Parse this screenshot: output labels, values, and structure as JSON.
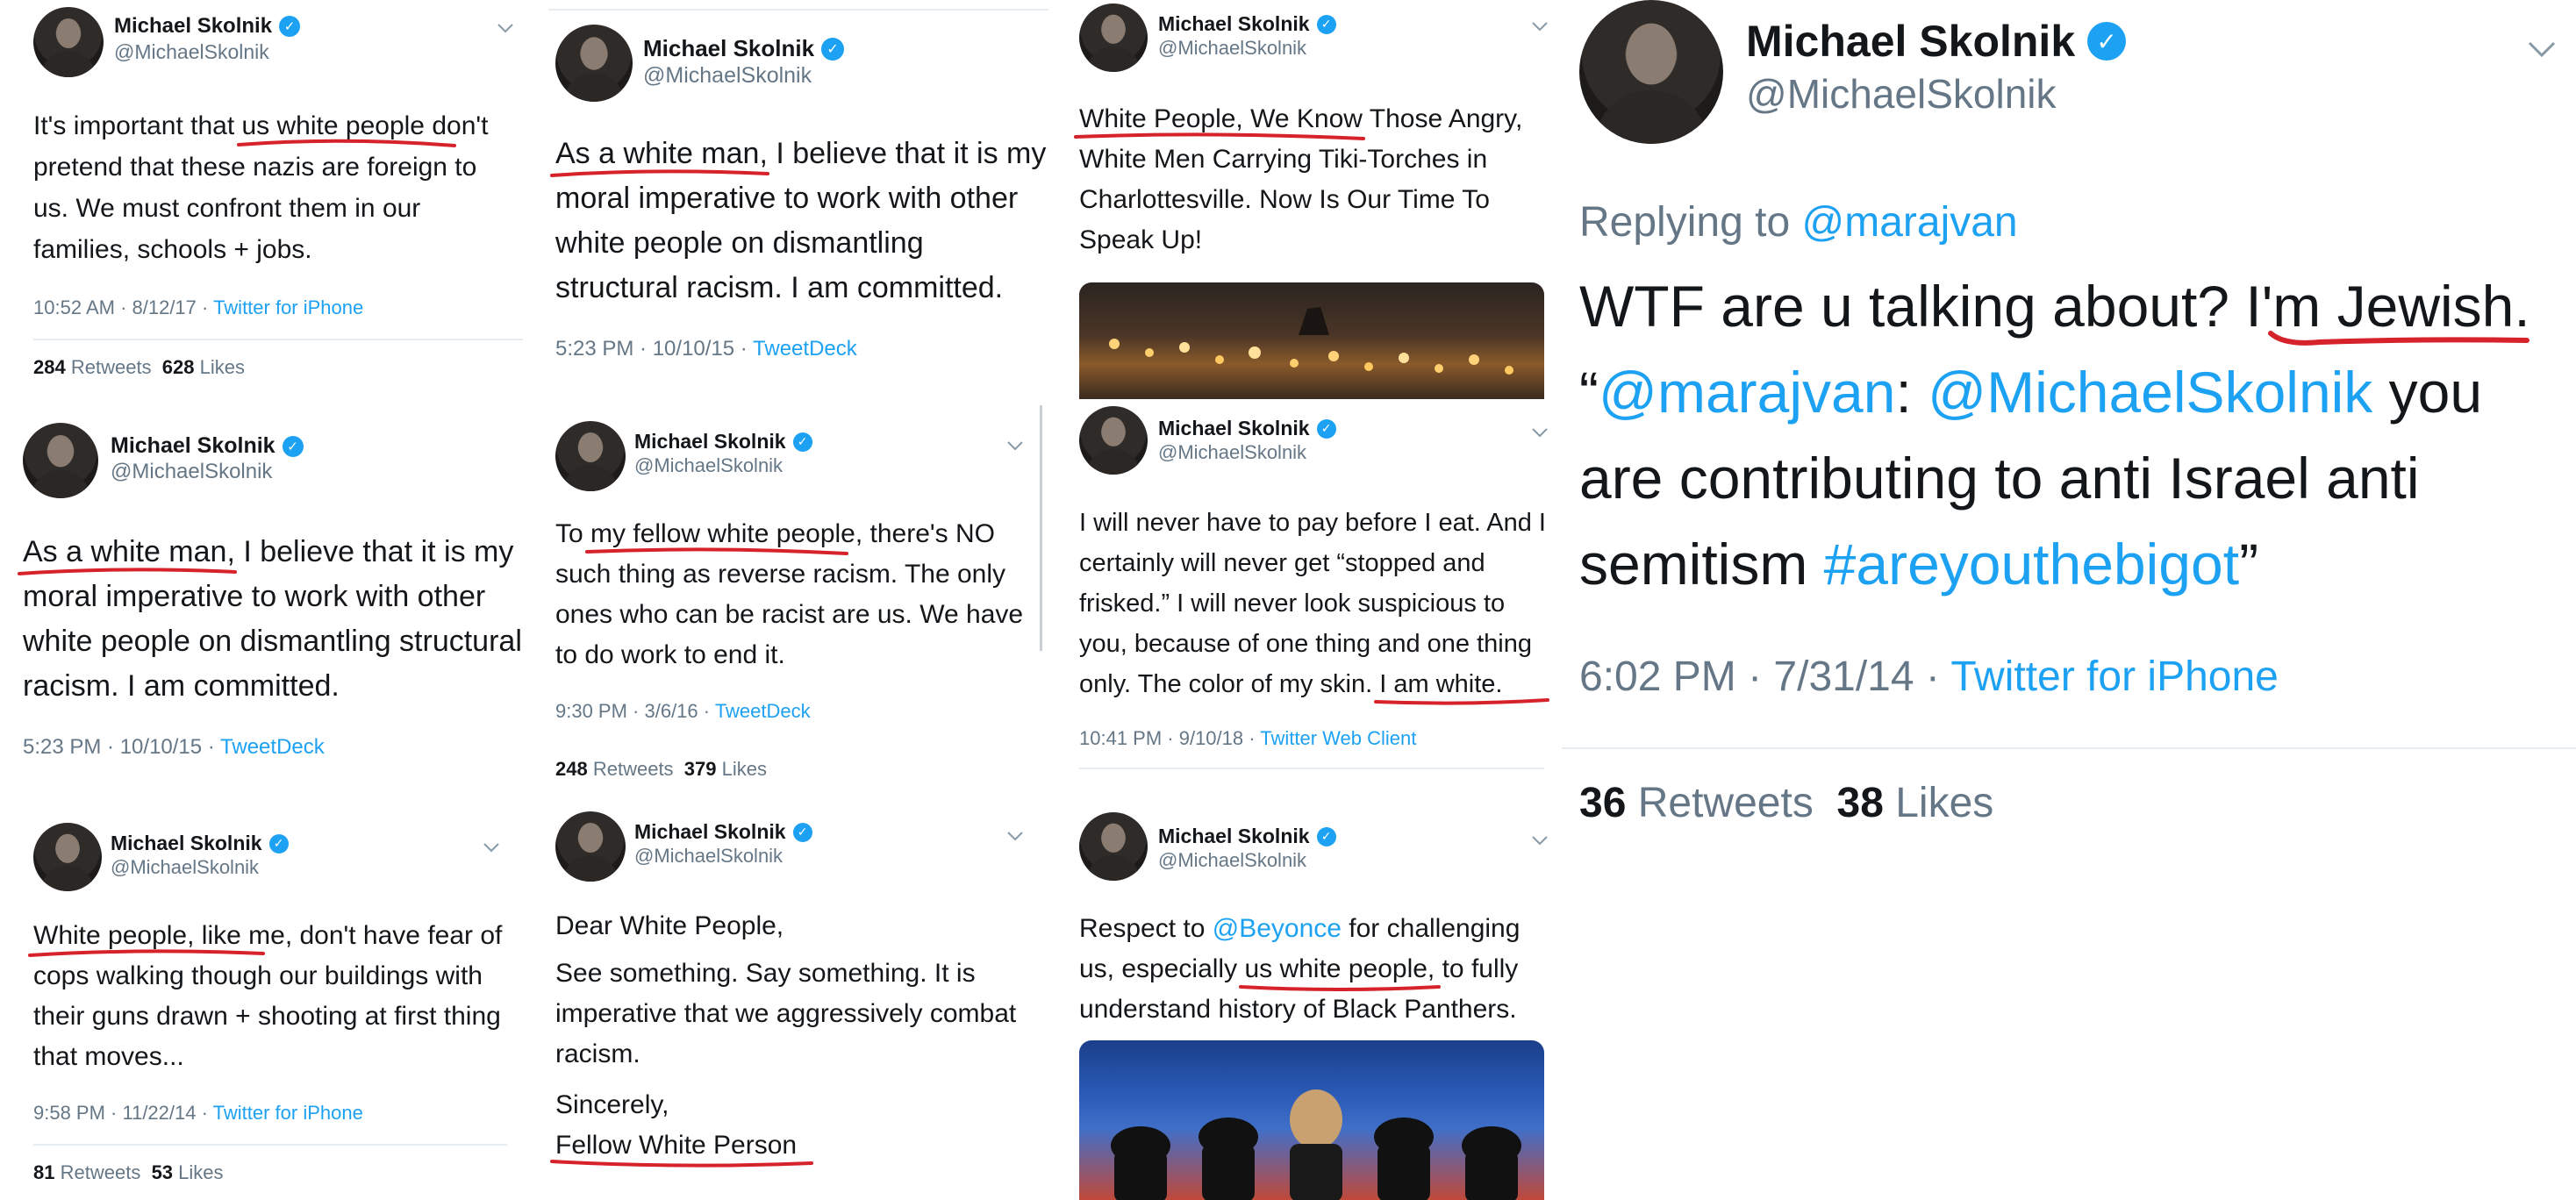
{
  "author": {
    "name": "Michael Skolnik",
    "handle": "@MichaelSkolnik"
  },
  "colors": {
    "accent": "#1da1f2",
    "underline": "#d6222a",
    "muted": "#657786",
    "text": "#14171a"
  },
  "icons": {
    "verified": "verified-badge-icon",
    "menu": "chevron-down-icon"
  },
  "t1": {
    "l1": "It's important that ",
    "u1": "us white people",
    "l2": " don't pretend that these nazis are foreign to us. We must confront them in our families, schools + jobs.",
    "time": "10:52 AM · 8/12/17 · ",
    "src": "Twitter for iPhone",
    "retweets": "284",
    "retweets_label": "Retweets",
    "likes": "628",
    "likes_label": "Likes"
  },
  "t2": {
    "u1": "As a white man, I",
    "l1": " believe that it is my moral imperative to work with other white people on dismantling structural racism. I am committed.",
    "time": "5:23 PM · 10/10/15 · ",
    "src": "TweetDeck"
  },
  "t3": {
    "u1": "White People, We Know",
    "l1": " Those Angry, White Men Carrying Tiki-Torches in Charlottesville. Now Is Our Time To Speak Up!"
  },
  "t4": {
    "u1": "As a white man, I",
    "l1": " believe that it is my moral imperative to work with other white people on dismantling structural racism. I am committed.",
    "time": "5:23 PM · 10/10/15 · ",
    "src": "TweetDeck"
  },
  "t5": {
    "l1": "To ",
    "u1": "my fellow white people",
    "l2": ", there's NO such thing as reverse racism. The only ones who can be racist are us. We have to do work to end it.",
    "time": "9:30 PM · 3/6/16 · ",
    "src": "TweetDeck",
    "retweets": "248",
    "retweets_label": "Retweets",
    "likes": "379",
    "likes_label": "Likes"
  },
  "t6": {
    "l1": "I will never have to pay before I eat. And I certainly will never get “stopped and frisked.”  I will never look suspicious to you, because of one thing and one thing only.  The color of my skin.  ",
    "u1": "I am white.",
    "time": "10:41 PM · 9/10/18 · ",
    "src": "Twitter Web Client"
  },
  "t7": {
    "u1": "White people, like me",
    "l1": ", don't have fear of cops walking though our buildings with their guns drawn + shooting at first thing that moves...",
    "time": "9:58 PM · 11/22/14 · ",
    "src": "Twitter for iPhone",
    "retweets": "81",
    "retweets_label": "Retweets",
    "likes": "53",
    "likes_label": "Likes"
  },
  "t8": {
    "p1": "Dear White People,",
    "p2": "See something. Say something. It is imperative that we aggressively combat racism.",
    "p3": "Sincerely,",
    "u1": "Fellow White Person"
  },
  "t9": {
    "l1": "Respect to ",
    "mention": "@Beyonce",
    "l2": " for challenging us, especially ",
    "u1": "us white people",
    "l3": ", to fully understand history of Black Panthers."
  },
  "t10": {
    "reply_label": "Replying to ",
    "reply_to": "@marajvan",
    "l1": "WTF are u talking about? I'",
    "u1": "m Jewish.",
    "l2": "“",
    "m1": "@marajvan",
    "l3": ": ",
    "m2": "@MichaelSkolnik",
    "l4": " you are contributing to anti Israel anti semitism ",
    "tag": "#areyouthebigot",
    "l5": "”",
    "time": "6:02 PM · 7/31/14 · ",
    "src": "Twitter for iPhone",
    "retweets": "36",
    "retweets_label": "Retweets",
    "likes": "38",
    "likes_label": "Likes"
  }
}
